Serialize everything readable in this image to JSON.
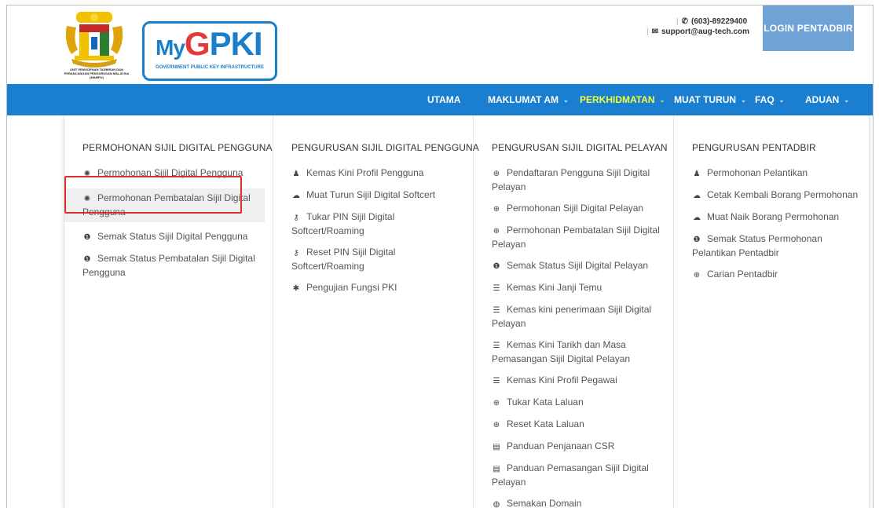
{
  "header": {
    "crest_caption": "UNIT PEMODENAN TADBIRAN DAN PERANCANGAN PENGURUSAN MALAYSIA (MAMPU)",
    "logo": {
      "my": "My",
      "word_a": "G",
      "word_b": "PKI",
      "subtitle": "GOVERNMENT PUBLIC KEY INFRASTRUCTURE"
    },
    "phone": "(603)-89229400",
    "email": "support@aug-tech.com",
    "login_label": "LOGIN PENTADBIR"
  },
  "nav": {
    "items": [
      {
        "label": "UTAMA",
        "caret": ""
      },
      {
        "label": "MAKLUMAT AM",
        "caret": "⌄"
      },
      {
        "label": "PERKHIDMATAN",
        "caret": "⌄"
      },
      {
        "label": "MUAT TURUN",
        "caret": "⌄"
      },
      {
        "label": "FAQ",
        "caret": "⌄"
      },
      {
        "label": "ADUAN",
        "caret": "⌄"
      }
    ],
    "active_color": "#f4ff3a",
    "bar_color": "#1a7fd1"
  },
  "menu": {
    "columns": [
      {
        "title": "PERMOHONAN SIJIL DIGITAL PENGGUNA",
        "items": [
          {
            "icon": "gear-icon",
            "glyph": "✺",
            "label": "Permohonan Sijil Digital Pengguna"
          },
          {
            "icon": "gear-icon",
            "glyph": "✺",
            "label": "Permohonan Pembatalan Sijil Digital Pengguna"
          },
          {
            "icon": "info-icon",
            "glyph": "❶",
            "label": "Semak Status Sijil Digital Pengguna"
          },
          {
            "icon": "info-icon",
            "glyph": "❶",
            "label": "Semak Status Pembatalan Sijil Digital Pengguna"
          }
        ]
      },
      {
        "title": "PENGURUSAN SIJIL DIGITAL PENGGUNA",
        "items": [
          {
            "icon": "user-icon",
            "glyph": "♟",
            "label": "Kemas Kini Profil Pengguna"
          },
          {
            "icon": "cloud-download-icon",
            "glyph": "☁",
            "label": "Muat Turun Sijil Digital Softcert"
          },
          {
            "icon": "key-icon",
            "glyph": "⚷",
            "label": "Tukar PIN Sijil Digital Softcert/Roaming"
          },
          {
            "icon": "key-icon",
            "glyph": "⚷",
            "label": "Reset PIN Sijil Digital Softcert/Roaming"
          },
          {
            "icon": "asterisk-icon",
            "glyph": "✱",
            "label": "Pengujian Fungsi PKI"
          }
        ]
      },
      {
        "title": "PENGURUSAN SIJIL DIGITAL PELAYAN",
        "items": [
          {
            "icon": "lock-icon",
            "glyph": "⊕",
            "label": "Pendaftaran Pengguna Sijil Digital Pelayan"
          },
          {
            "icon": "lock-icon",
            "glyph": "⊕",
            "label": "Permohonan Sijil Digital Pelayan"
          },
          {
            "icon": "lock-icon",
            "glyph": "⊕",
            "label": "Permohonan Pembatalan Sijil Digital Pelayan"
          },
          {
            "icon": "info-icon",
            "glyph": "❶",
            "label": "Semak Status Sijil Digital Pelayan"
          },
          {
            "icon": "list-icon",
            "glyph": "☰",
            "label": "Kemas Kini Janji Temu"
          },
          {
            "icon": "list-icon",
            "glyph": "☰",
            "label": "Kemas kini penerimaan Sijil Digital Pelayan"
          },
          {
            "icon": "list-icon",
            "glyph": "☰",
            "label": "Kemas Kini Tarikh dan Masa Pemasangan Sijil Digital Pelayan"
          },
          {
            "icon": "list-icon",
            "glyph": "☰",
            "label": "Kemas Kini Profil Pegawai"
          },
          {
            "icon": "lock-icon",
            "glyph": "⊕",
            "label": "Tukar Kata Laluan"
          },
          {
            "icon": "lock-icon",
            "glyph": "⊕",
            "label": "Reset Kata Laluan"
          },
          {
            "icon": "document-icon",
            "glyph": "▤",
            "label": "Panduan Penjanaan CSR"
          },
          {
            "icon": "document-icon",
            "glyph": "▤",
            "label": "Panduan Pemasangan Sijil Digital Pelayan"
          },
          {
            "icon": "globe-icon",
            "glyph": "◍",
            "label": "Semakan Domain"
          }
        ]
      },
      {
        "title": "PENGURUSAN PENTADBIR",
        "items": [
          {
            "icon": "user-icon",
            "glyph": "♟",
            "label": "Permohonan Pelantikan"
          },
          {
            "icon": "cloud-icon",
            "glyph": "☁",
            "label": "Cetak Kembali Borang Permohonan"
          },
          {
            "icon": "cloud-upload-icon",
            "glyph": "☁",
            "label": "Muat Naik Borang Permohonan"
          },
          {
            "icon": "info-icon",
            "glyph": "❶",
            "label": "Semak Status Permohonan Pelantikan Pentadbir"
          },
          {
            "icon": "search-icon",
            "glyph": "⊕",
            "label": "Carian Pentadbir"
          }
        ]
      }
    ]
  }
}
